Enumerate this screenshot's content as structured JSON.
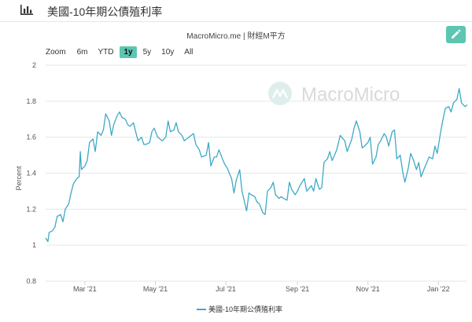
{
  "header": {
    "title": "美國-10年期公債殖利率",
    "icon": "bar-chart-icon"
  },
  "source": "MacroMicro.me | 財經M平方",
  "watermark": "MacroMicro",
  "edit_icon": "pencil-icon",
  "zoom": {
    "label": "Zoom",
    "options": [
      "6m",
      "YTD",
      "1y",
      "5y",
      "10y",
      "All"
    ],
    "selected": "1y"
  },
  "colors": {
    "line": "#3fa9c6",
    "accent": "#5cc6b2",
    "grid": "#e6e6e6"
  },
  "chart_data": {
    "type": "line",
    "title": "",
    "xlabel": "",
    "ylabel": "Percent",
    "ylim": [
      0.8,
      2.0
    ],
    "yticks": [
      0.8,
      1,
      1.2,
      1.4,
      1.6,
      1.8,
      2
    ],
    "xlim": [
      "2021-01-26",
      "2022-01-26"
    ],
    "xticks": [
      {
        "date": "2021-03-01",
        "label": "Mar '21"
      },
      {
        "date": "2021-05-01",
        "label": "May '21"
      },
      {
        "date": "2021-07-01",
        "label": "Jul '21"
      },
      {
        "date": "2021-09-01",
        "label": "Sep '21"
      },
      {
        "date": "2021-11-01",
        "label": "Nov '21"
      },
      {
        "date": "2022-01-01",
        "label": "Jan '22"
      }
    ],
    "grid": true,
    "legend_position": "bottom",
    "series": [
      {
        "name": "美國-10年期公債殖利率",
        "points": [
          [
            "2021-01-26",
            1.04
          ],
          [
            "2021-01-28",
            1.02
          ],
          [
            "2021-01-29",
            1.07
          ],
          [
            "2021-02-01",
            1.08
          ],
          [
            "2021-02-03",
            1.1
          ],
          [
            "2021-02-05",
            1.16
          ],
          [
            "2021-02-08",
            1.17
          ],
          [
            "2021-02-10",
            1.13
          ],
          [
            "2021-02-12",
            1.2
          ],
          [
            "2021-02-15",
            1.23
          ],
          [
            "2021-02-17",
            1.29
          ],
          [
            "2021-02-19",
            1.34
          ],
          [
            "2021-02-22",
            1.37
          ],
          [
            "2021-02-24",
            1.38
          ],
          [
            "2021-02-25",
            1.52
          ],
          [
            "2021-02-26",
            1.42
          ],
          [
            "2021-03-01",
            1.44
          ],
          [
            "2021-03-03",
            1.47
          ],
          [
            "2021-03-05",
            1.57
          ],
          [
            "2021-03-08",
            1.59
          ],
          [
            "2021-03-10",
            1.52
          ],
          [
            "2021-03-12",
            1.63
          ],
          [
            "2021-03-15",
            1.61
          ],
          [
            "2021-03-17",
            1.64
          ],
          [
            "2021-03-19",
            1.73
          ],
          [
            "2021-03-22",
            1.69
          ],
          [
            "2021-03-24",
            1.61
          ],
          [
            "2021-03-26",
            1.67
          ],
          [
            "2021-03-29",
            1.72
          ],
          [
            "2021-03-31",
            1.74
          ],
          [
            "2021-04-02",
            1.71
          ],
          [
            "2021-04-05",
            1.7
          ],
          [
            "2021-04-07",
            1.67
          ],
          [
            "2021-04-09",
            1.66
          ],
          [
            "2021-04-12",
            1.68
          ],
          [
            "2021-04-14",
            1.63
          ],
          [
            "2021-04-16",
            1.58
          ],
          [
            "2021-04-19",
            1.6
          ],
          [
            "2021-04-21",
            1.56
          ],
          [
            "2021-04-23",
            1.56
          ],
          [
            "2021-04-26",
            1.57
          ],
          [
            "2021-04-28",
            1.63
          ],
          [
            "2021-04-30",
            1.65
          ],
          [
            "2021-05-03",
            1.6
          ],
          [
            "2021-05-05",
            1.59
          ],
          [
            "2021-05-07",
            1.58
          ],
          [
            "2021-05-10",
            1.6
          ],
          [
            "2021-05-12",
            1.69
          ],
          [
            "2021-05-14",
            1.63
          ],
          [
            "2021-05-17",
            1.64
          ],
          [
            "2021-05-19",
            1.68
          ],
          [
            "2021-05-21",
            1.63
          ],
          [
            "2021-05-24",
            1.61
          ],
          [
            "2021-05-26",
            1.58
          ],
          [
            "2021-05-28",
            1.59
          ],
          [
            "2021-06-01",
            1.61
          ],
          [
            "2021-06-03",
            1.62
          ],
          [
            "2021-06-05",
            1.56
          ],
          [
            "2021-06-08",
            1.53
          ],
          [
            "2021-06-10",
            1.49
          ],
          [
            "2021-06-14",
            1.5
          ],
          [
            "2021-06-16",
            1.57
          ],
          [
            "2021-06-18",
            1.44
          ],
          [
            "2021-06-21",
            1.49
          ],
          [
            "2021-06-23",
            1.49
          ],
          [
            "2021-06-25",
            1.53
          ],
          [
            "2021-06-28",
            1.48
          ],
          [
            "2021-06-30",
            1.45
          ],
          [
            "2021-07-02",
            1.43
          ],
          [
            "2021-07-06",
            1.37
          ],
          [
            "2021-07-08",
            1.29
          ],
          [
            "2021-07-10",
            1.36
          ],
          [
            "2021-07-13",
            1.42
          ],
          [
            "2021-07-15",
            1.3
          ],
          [
            "2021-07-19",
            1.19
          ],
          [
            "2021-07-21",
            1.29
          ],
          [
            "2021-07-23",
            1.28
          ],
          [
            "2021-07-26",
            1.27
          ],
          [
            "2021-07-28",
            1.24
          ],
          [
            "2021-07-30",
            1.23
          ],
          [
            "2021-08-02",
            1.18
          ],
          [
            "2021-08-04",
            1.17
          ],
          [
            "2021-08-06",
            1.3
          ],
          [
            "2021-08-09",
            1.32
          ],
          [
            "2021-08-11",
            1.35
          ],
          [
            "2021-08-13",
            1.28
          ],
          [
            "2021-08-16",
            1.26
          ],
          [
            "2021-08-18",
            1.27
          ],
          [
            "2021-08-20",
            1.26
          ],
          [
            "2021-08-23",
            1.25
          ],
          [
            "2021-08-25",
            1.35
          ],
          [
            "2021-08-27",
            1.31
          ],
          [
            "2021-08-30",
            1.28
          ],
          [
            "2021-09-01",
            1.3
          ],
          [
            "2021-09-03",
            1.33
          ],
          [
            "2021-09-07",
            1.37
          ],
          [
            "2021-09-09",
            1.3
          ],
          [
            "2021-09-13",
            1.33
          ],
          [
            "2021-09-15",
            1.3
          ],
          [
            "2021-09-17",
            1.37
          ],
          [
            "2021-09-20",
            1.31
          ],
          [
            "2021-09-22",
            1.32
          ],
          [
            "2021-09-24",
            1.46
          ],
          [
            "2021-09-27",
            1.48
          ],
          [
            "2021-09-29",
            1.52
          ],
          [
            "2021-10-01",
            1.47
          ],
          [
            "2021-10-05",
            1.53
          ],
          [
            "2021-10-08",
            1.61
          ],
          [
            "2021-10-12",
            1.58
          ],
          [
            "2021-10-14",
            1.52
          ],
          [
            "2021-10-18",
            1.59
          ],
          [
            "2021-10-20",
            1.65
          ],
          [
            "2021-10-22",
            1.69
          ],
          [
            "2021-10-25",
            1.63
          ],
          [
            "2021-10-27",
            1.54
          ],
          [
            "2021-10-29",
            1.55
          ],
          [
            "2021-11-01",
            1.57
          ],
          [
            "2021-11-03",
            1.6
          ],
          [
            "2021-11-05",
            1.45
          ],
          [
            "2021-11-08",
            1.49
          ],
          [
            "2021-11-10",
            1.56
          ],
          [
            "2021-11-12",
            1.58
          ],
          [
            "2021-11-15",
            1.62
          ],
          [
            "2021-11-17",
            1.6
          ],
          [
            "2021-11-19",
            1.55
          ],
          [
            "2021-11-22",
            1.63
          ],
          [
            "2021-11-24",
            1.64
          ],
          [
            "2021-11-26",
            1.48
          ],
          [
            "2021-11-29",
            1.5
          ],
          [
            "2021-12-01",
            1.41
          ],
          [
            "2021-12-03",
            1.35
          ],
          [
            "2021-12-06",
            1.43
          ],
          [
            "2021-12-08",
            1.51
          ],
          [
            "2021-12-10",
            1.48
          ],
          [
            "2021-12-13",
            1.42
          ],
          [
            "2021-12-15",
            1.46
          ],
          [
            "2021-12-17",
            1.38
          ],
          [
            "2021-12-20",
            1.43
          ],
          [
            "2021-12-22",
            1.46
          ],
          [
            "2021-12-24",
            1.49
          ],
          [
            "2021-12-27",
            1.48
          ],
          [
            "2021-12-29",
            1.55
          ],
          [
            "2021-12-31",
            1.51
          ],
          [
            "2022-01-03",
            1.63
          ],
          [
            "2022-01-05",
            1.7
          ],
          [
            "2022-01-07",
            1.76
          ],
          [
            "2022-01-10",
            1.77
          ],
          [
            "2022-01-12",
            1.74
          ],
          [
            "2022-01-14",
            1.79
          ],
          [
            "2022-01-17",
            1.81
          ],
          [
            "2022-01-19",
            1.87
          ],
          [
            "2022-01-21",
            1.79
          ],
          [
            "2022-01-24",
            1.77
          ],
          [
            "2022-01-26",
            1.78
          ]
        ]
      }
    ]
  }
}
